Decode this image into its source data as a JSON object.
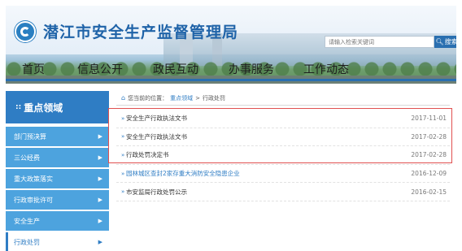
{
  "header": {
    "site_title": "潜江市安全生产监督管理局",
    "search": {
      "placeholder": "请输入检索关键词",
      "button_label": "搜索"
    }
  },
  "nav": {
    "items": [
      {
        "label": "首页"
      },
      {
        "label": "信息公开"
      },
      {
        "label": "政民互动"
      },
      {
        "label": "办事服务"
      },
      {
        "label": "工作动态"
      }
    ]
  },
  "sidebar": {
    "heading": "重点领域",
    "items": [
      {
        "label": "部门预决算"
      },
      {
        "label": "三公经费"
      },
      {
        "label": "重大政策落实"
      },
      {
        "label": "行政审批许可"
      },
      {
        "label": "安全生产"
      },
      {
        "label": "行政处罚"
      }
    ],
    "active": "行政处罚"
  },
  "breadcrumb": {
    "prefix": "您当前的位置：",
    "crumbs": [
      "重点领域",
      "行政处罚"
    ],
    "separator": ">"
  },
  "articles": [
    {
      "title": "安全生产行政执法文书",
      "date": "2017-11-01"
    },
    {
      "title": "安全生产行政执法文书",
      "date": "2017-02-28"
    },
    {
      "title": "行政处罚决定书",
      "date": "2017-02-28"
    },
    {
      "title": "园林城区查封2家存重大消防安全隐患企业",
      "date": "2016-12-09"
    },
    {
      "title": "市安监局行政处罚公示",
      "date": "2016-02-15"
    }
  ],
  "colors": {
    "brand_blue": "#2f7dc4",
    "sidebar_item": "#4da3de",
    "highlight_border": "#e05050"
  },
  "icons": {
    "home": "home-icon",
    "search": "search-icon",
    "bullet": "chevron-right-icon"
  }
}
